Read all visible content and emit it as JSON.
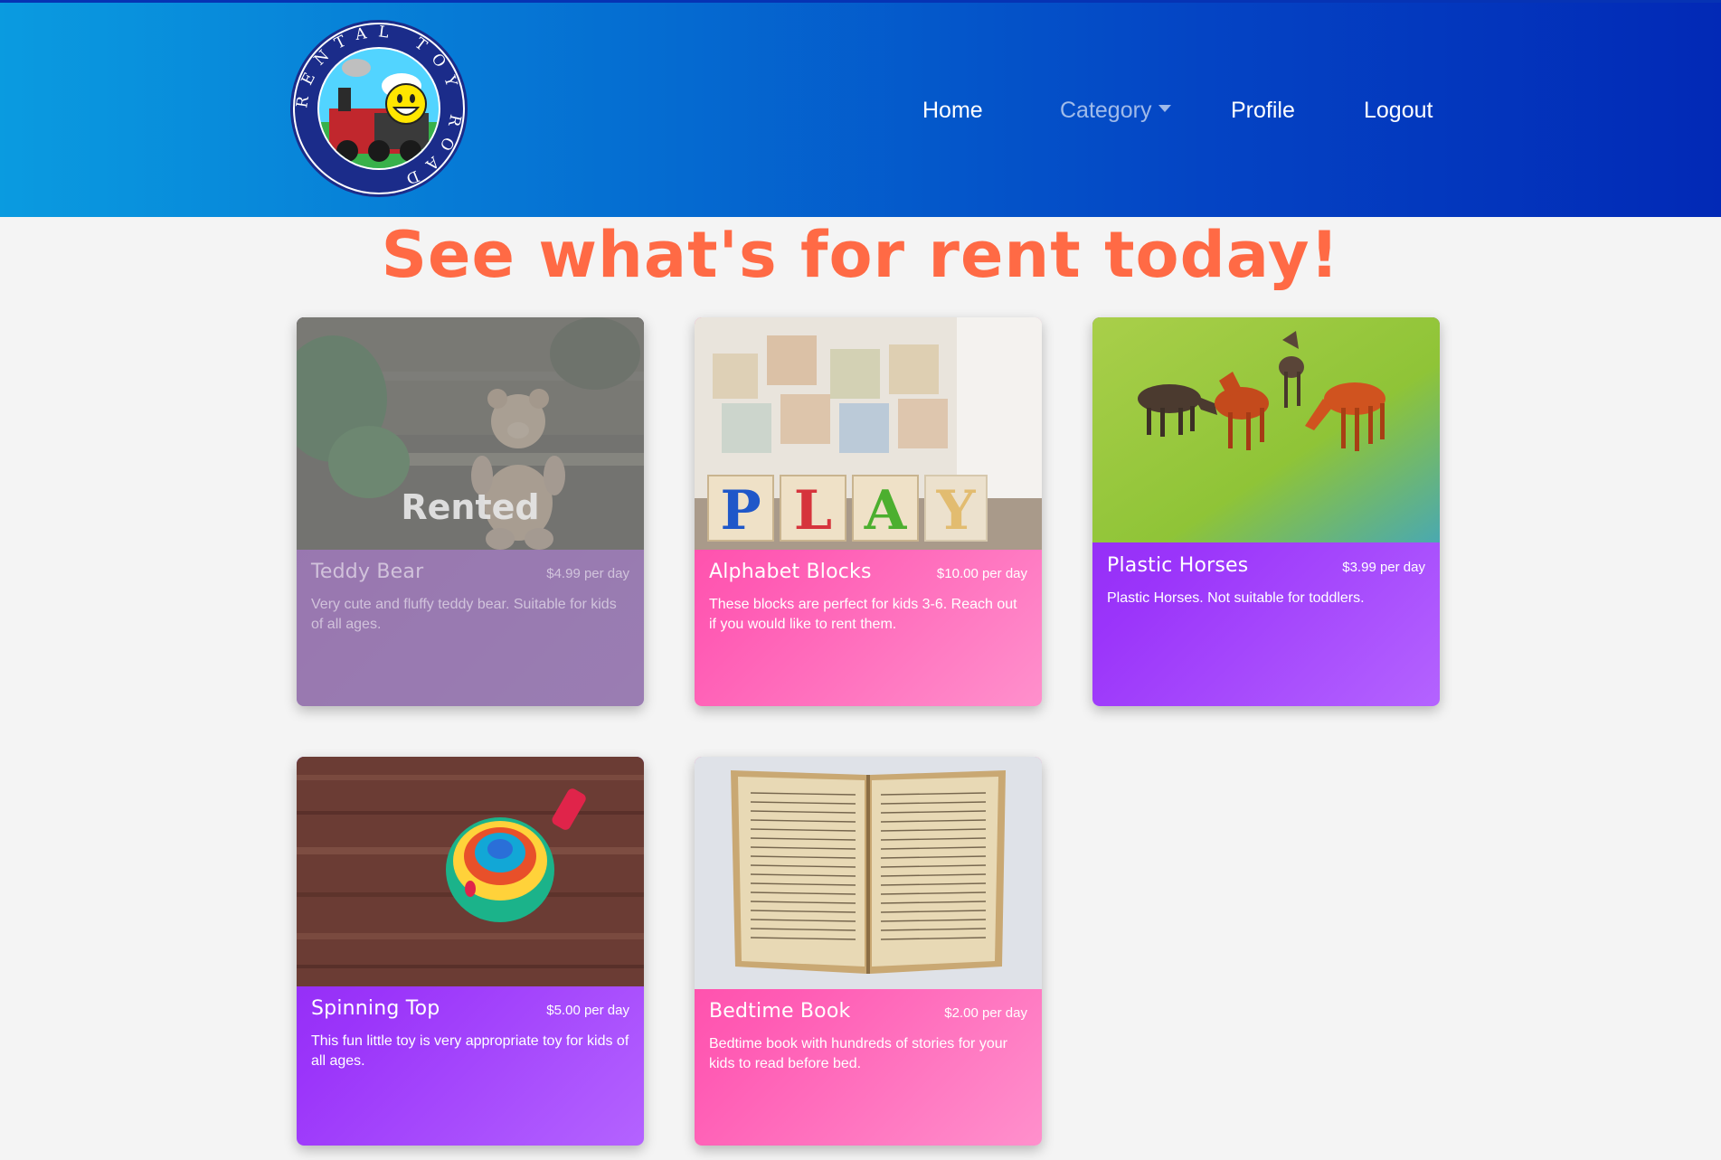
{
  "nav": {
    "logo_alt": "Rental Toy Road logo",
    "logo_ring_text": "RENTAL TOY ROAD",
    "home": "Home",
    "category": "Category",
    "profile": "Profile",
    "logout": "Logout"
  },
  "heading": "See what's for rent today!",
  "products": [
    {
      "title": "Teddy Bear",
      "price": "$4.99 per day",
      "description": "Very cute and fluffy teddy bear. Suitable for kids of all ages.",
      "status": "Rented",
      "image_icon": "teddy-bear-icon"
    },
    {
      "title": "Alphabet Blocks",
      "price": "$10.00 per day",
      "description": "These blocks are perfect for kids 3-6. Reach out if you would like to rent them.",
      "image_icon": "alphabet-blocks-icon",
      "block_letters": [
        "P",
        "L",
        "A",
        "Y"
      ]
    },
    {
      "title": "Plastic Horses",
      "price": "$3.99 per day",
      "description": "Plastic Horses. Not suitable for toddlers.",
      "image_icon": "plastic-horses-icon"
    },
    {
      "title": "Spinning Top",
      "price": "$5.00 per day",
      "description": "This fun little toy is very appropriate toy for kids of all ages.",
      "image_icon": "spinning-top-icon"
    },
    {
      "title": "Bedtime Book",
      "price": "$2.00 per day",
      "description": "Bedtime book with hundreds of stories for your kids to read before bed.",
      "image_icon": "open-book-icon"
    }
  ],
  "colors": {
    "heading": "#ff6a45",
    "card_pink": "#ff5bb4",
    "card_purple": "#9b35fa",
    "nav_start": "#0a9be0",
    "nav_end": "#0229b6"
  }
}
